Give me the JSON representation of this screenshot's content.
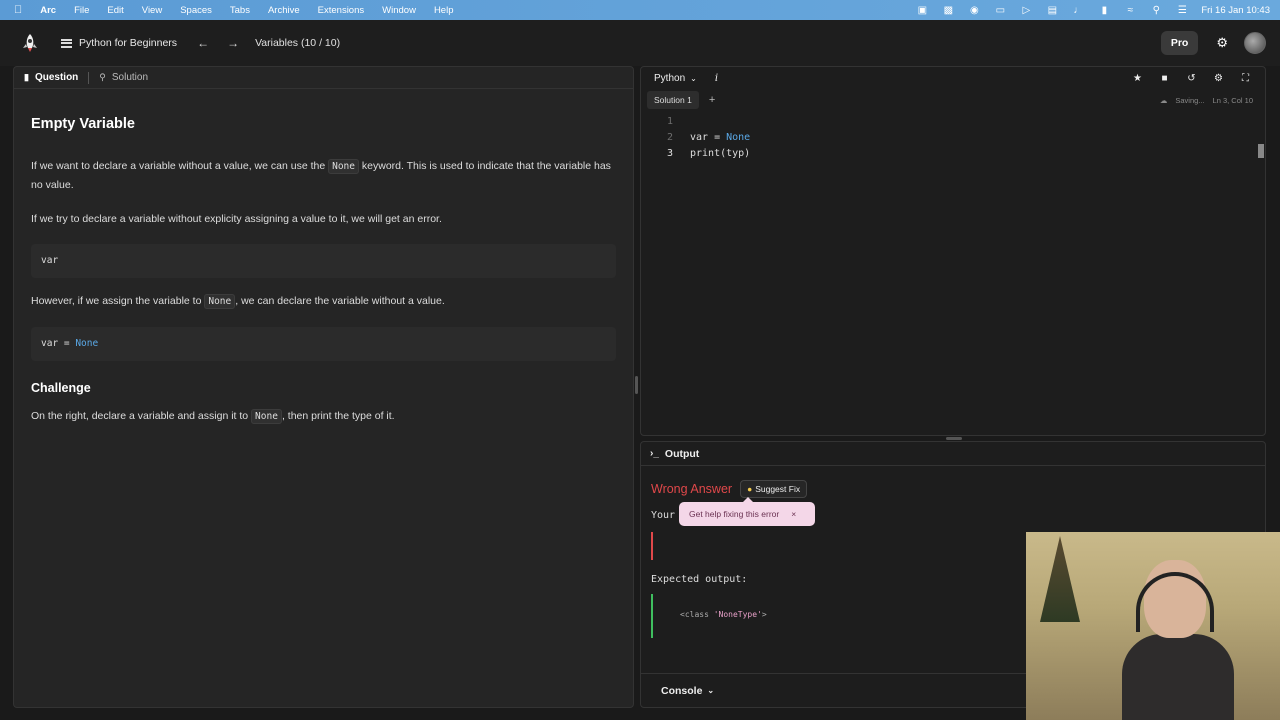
{
  "menubar": {
    "app": "Arc",
    "items": [
      "File",
      "Edit",
      "View",
      "Spaces",
      "Tabs",
      "Archive",
      "Extensions",
      "Window",
      "Help"
    ],
    "clock": "Fri 16 Jan  10:43"
  },
  "header": {
    "course": "Python for Beginners",
    "lesson": "Variables (10 / 10)",
    "pro_label": "Pro"
  },
  "left": {
    "tabs": [
      "Question",
      "Solution"
    ],
    "title": "Empty Variable",
    "p1_pre": "If we want to declare a variable without a value, we can use the ",
    "p1_code": "None",
    "p1_post": " keyword. This is used to indicate that the variable has no value.",
    "p2": "If we try to declare a variable without explicity assigning a value to it, we will get an error.",
    "code1": "var",
    "p3_pre": "However, if we assign the variable to ",
    "p3_code": "None",
    "p3_post": ", we can declare the variable without a value.",
    "code2_var": "var = ",
    "code2_kw": "None",
    "challenge_title": "Challenge",
    "c_pre": "On the right, declare a variable and assign it to ",
    "c_code": "None",
    "c_post": ", then print the type of it."
  },
  "editor": {
    "language": "Python",
    "info": "i",
    "tab": "Solution 1",
    "add": "+",
    "saving": "Saving...",
    "position": "Ln 3, Col 10",
    "lines": [
      {
        "n": "1",
        "text": ""
      },
      {
        "n": "2",
        "text": "var = ",
        "kw": "None"
      },
      {
        "n": "3",
        "text": "print(typ)"
      }
    ]
  },
  "output": {
    "title": "Output",
    "result": "Wrong Answer",
    "suggest_fix": "Suggest Fix",
    "your_label": "Your",
    "tooltip": "Get help fixing this error",
    "tooltip_close": "×",
    "expected_label": "Expected output:",
    "expected_pre": "<class ",
    "expected_str": "'NoneType'",
    "expected_post": ">",
    "console": "Console"
  },
  "colors": {
    "wrong": "#e0484a",
    "success": "#3fbf5f",
    "keyword": "#5aa8e6",
    "tooltip_bg": "#f4d7e8"
  }
}
